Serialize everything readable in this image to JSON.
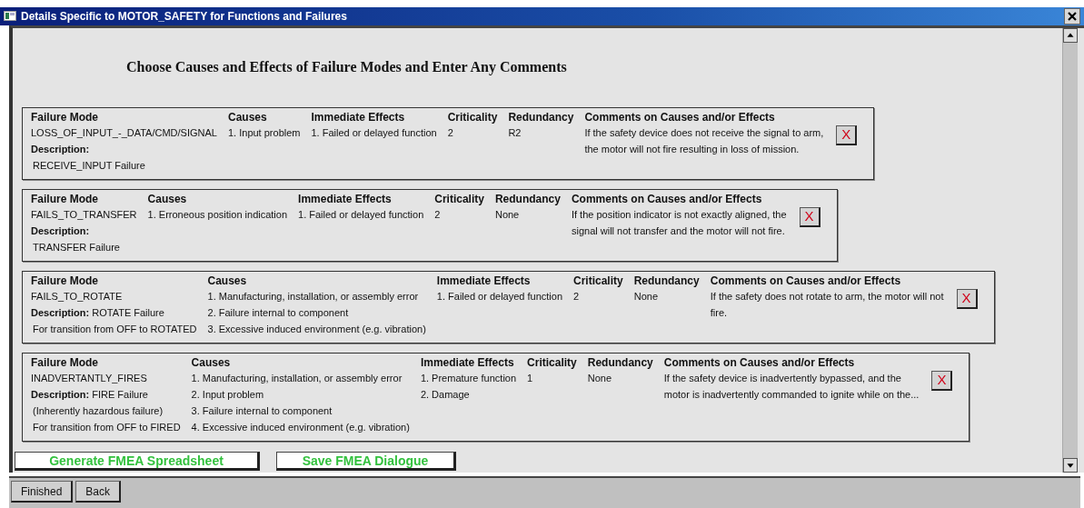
{
  "window": {
    "title": "Details Specific to MOTOR_SAFETY for Functions and Failures"
  },
  "heading": "Choose Causes and Effects of Failure Modes and Enter Any Comments",
  "failure_modes": [
    {
      "columns": [
        {
          "header": "Failure Mode",
          "lines": [
            "LOSS_OF_INPUT_-_DATA/CMD/SIGNAL",
            "**Description:**",
            "RECEIVE_INPUT Failure"
          ]
        },
        {
          "header": "Causes",
          "lines": [
            "1. Input problem"
          ]
        },
        {
          "header": "Immediate Effects",
          "lines": [
            "1. Failed or delayed function"
          ]
        },
        {
          "header": "Criticality",
          "lines": [
            "2"
          ]
        },
        {
          "header": "Redundancy",
          "lines": [
            "R2"
          ]
        },
        {
          "header": "Comments on Causes and/or Effects",
          "lines": [
            "If the safety device does not receive the signal to arm,",
            "the motor will not fire resulting in loss of mission."
          ]
        }
      ],
      "remove_button": "X"
    },
    {
      "columns": [
        {
          "header": "Failure Mode",
          "lines": [
            "FAILS_TO_TRANSFER",
            "**Description:**",
            "TRANSFER Failure"
          ]
        },
        {
          "header": "Causes",
          "lines": [
            "1. Erroneous position indication"
          ]
        },
        {
          "header": "Immediate Effects",
          "lines": [
            "1. Failed or delayed function"
          ]
        },
        {
          "header": "Criticality",
          "lines": [
            "2"
          ]
        },
        {
          "header": "Redundancy",
          "lines": [
            "None"
          ]
        },
        {
          "header": "Comments on Causes and/or Effects",
          "lines": [
            "If the position indicator is not exactly aligned, the",
            "signal will not transfer and the motor will not fire."
          ]
        }
      ],
      "remove_button": "X"
    },
    {
      "columns": [
        {
          "header": "Failure Mode",
          "lines": [
            "FAILS_TO_ROTATE",
            "**Description:** ROTATE Failure",
            "For transition from OFF to ROTATED"
          ]
        },
        {
          "header": "Causes",
          "lines": [
            "1. Manufacturing, installation, or assembly error",
            "2. Failure internal to component",
            "3. Excessive induced environment (e.g. vibration)"
          ]
        },
        {
          "header": "Immediate Effects",
          "lines": [
            "1. Failed or delayed function"
          ]
        },
        {
          "header": "Criticality",
          "lines": [
            "2"
          ]
        },
        {
          "header": "Redundancy",
          "lines": [
            "None"
          ]
        },
        {
          "header": "Comments on Causes and/or Effects",
          "lines": [
            "If the safety does not rotate to arm, the motor will not",
            "fire."
          ]
        }
      ],
      "remove_button": "X"
    },
    {
      "columns": [
        {
          "header": "Failure Mode",
          "lines": [
            "INADVERTANTLY_FIRES",
            "**Description:** FIRE Failure",
            "(Inherently hazardous failure)",
            "For transition from OFF to FIRED"
          ]
        },
        {
          "header": "Causes",
          "lines": [
            "1. Manufacturing, installation, or assembly error",
            "2. Input problem",
            "3. Failure internal to component",
            "4. Excessive induced environment (e.g. vibration)"
          ]
        },
        {
          "header": "Immediate Effects",
          "lines": [
            "1. Premature function",
            "2. Damage"
          ]
        },
        {
          "header": "Criticality",
          "lines": [
            "1"
          ]
        },
        {
          "header": "Redundancy",
          "lines": [
            "None"
          ]
        },
        {
          "header": "Comments on Causes and/or Effects",
          "lines": [
            "If the safety device is inadvertently bypassed, and the",
            "motor is inadvertently commanded to ignite while on the..."
          ]
        }
      ],
      "remove_button": "X"
    }
  ],
  "actions": [
    "Generate FMEA Spreadsheet",
    "Save FMEA Dialogue"
  ],
  "footer_buttons": [
    "Finished",
    "Back"
  ]
}
